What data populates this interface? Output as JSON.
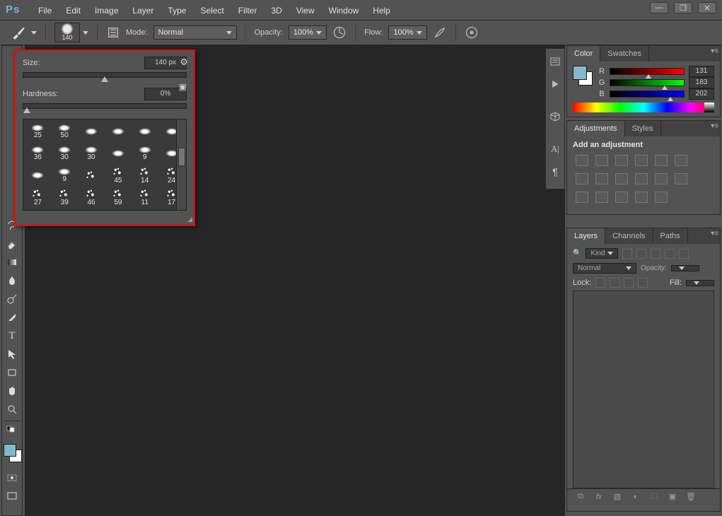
{
  "menu": [
    "File",
    "Edit",
    "Image",
    "Layer",
    "Type",
    "Select",
    "Filter",
    "3D",
    "View",
    "Window",
    "Help"
  ],
  "options": {
    "brush_size": "140",
    "mode_label": "Mode:",
    "mode_value": "Normal",
    "opacity_label": "Opacity:",
    "opacity_value": "100%",
    "flow_label": "Flow:",
    "flow_value": "100%"
  },
  "brush_popup": {
    "size_label": "Size:",
    "size_value": "140 px",
    "hardness_label": "Hardness:",
    "hardness_value": "0%",
    "presets": [
      25,
      50,
      "",
      "",
      "",
      "",
      36,
      30,
      30,
      "",
      9,
      "",
      "",
      9,
      "",
      45,
      14,
      24,
      27,
      39,
      46,
      59,
      11,
      17
    ]
  },
  "panels": {
    "color_tab": "Color",
    "swatches_tab": "Swatches",
    "color": {
      "r_label": "R",
      "g_label": "G",
      "b_label": "B",
      "r": "131",
      "g": "183",
      "b": "202"
    },
    "adjust_tab": "Adjustments",
    "styles_tab": "Styles",
    "adjust_title": "Add an adjustment",
    "layers_tab": "Layers",
    "channels_tab": "Channels",
    "paths_tab": "Paths",
    "layers": {
      "kind_label": "Kind",
      "blend_value": "Normal",
      "opacity_label": "Opacity:",
      "lock_label": "Lock:",
      "fill_label": "Fill:",
      "search_icon": "🔍"
    }
  }
}
